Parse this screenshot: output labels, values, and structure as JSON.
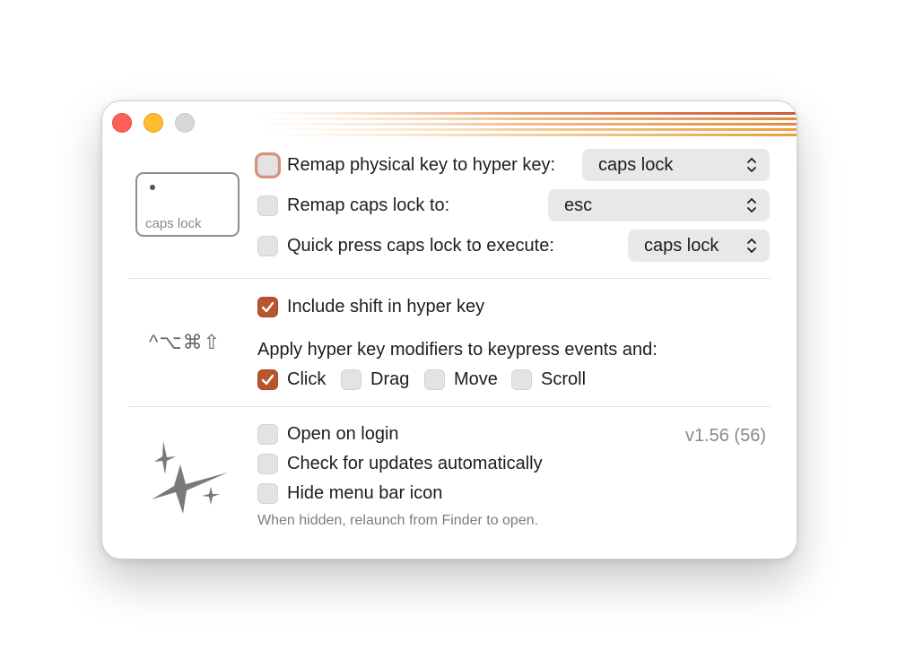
{
  "window": {
    "accent_color": "#b8552e",
    "traffic_lights": [
      "close",
      "minimize",
      "zoom"
    ]
  },
  "keycap": {
    "label": "caps lock"
  },
  "remap": {
    "physical_key": {
      "label": "Remap physical key to hyper key:",
      "checked": false,
      "value": "caps lock"
    },
    "caps_lock_to": {
      "label": "Remap caps lock to:",
      "checked": false,
      "value": "esc"
    },
    "quick_press": {
      "label": "Quick press caps lock to execute:",
      "checked": false,
      "value": "caps lock"
    }
  },
  "modifiers": {
    "symbols": "^⌥⌘⇧",
    "include_shift": {
      "label": "Include shift in hyper key",
      "checked": true
    },
    "apply_heading": "Apply hyper key modifiers to keypress events and:",
    "events": [
      {
        "label": "Click",
        "checked": true
      },
      {
        "label": "Drag",
        "checked": false
      },
      {
        "label": "Move",
        "checked": false
      },
      {
        "label": "Scroll",
        "checked": false
      }
    ]
  },
  "general": {
    "open_on_login": {
      "label": "Open on login",
      "checked": false
    },
    "check_updates": {
      "label": "Check for updates automatically",
      "checked": false
    },
    "hide_menu_bar": {
      "label": "Hide menu bar icon",
      "checked": false
    },
    "hint": "When hidden, relaunch from Finder to open.",
    "version": "v1.56 (56)"
  },
  "icons": {
    "popup_chevron": "chevron-updown-icon",
    "checkmark": "checkmark-icon",
    "sparkles": "sparkles-icon"
  }
}
